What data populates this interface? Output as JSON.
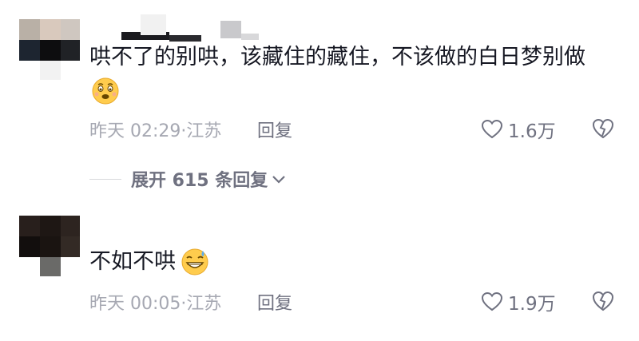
{
  "comments": [
    {
      "text": "哄不了的别哄，该藏住的藏住，不该做的白日梦别做",
      "emoji": "woozy-face-emoji",
      "time": "昨天 02:29",
      "location": "·江苏",
      "reply_label": "回复",
      "likes": "1.6万"
    },
    {
      "text": "不如不哄",
      "emoji": "grinning-sweat-emoji",
      "time": "昨天 00:05",
      "location": "·江苏",
      "reply_label": "回复",
      "likes": "1.9万"
    }
  ],
  "expand_replies": {
    "label": "展开 615 条回复"
  },
  "icons": {
    "like": "heart-outline-icon",
    "dislike": "broken-heart-icon",
    "chevron": "chevron-down-icon"
  },
  "colors": {
    "text": "#161823",
    "meta": "#a6a8b2",
    "action": "#6f7180"
  }
}
